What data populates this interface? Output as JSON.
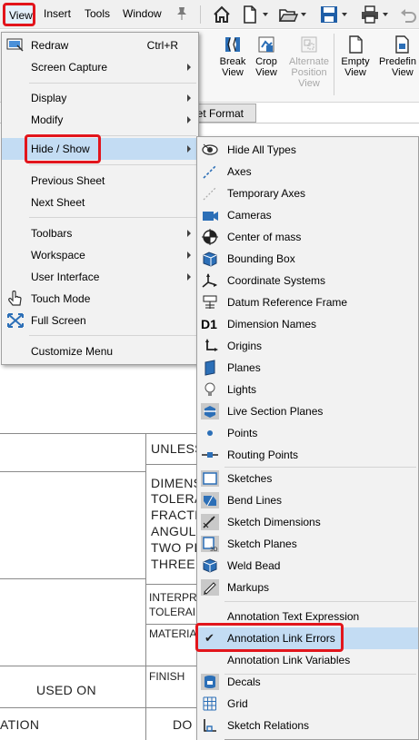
{
  "menubar": {
    "items": [
      "View",
      "Insert",
      "Tools",
      "Window"
    ],
    "pin_icon": "pin-icon"
  },
  "toolbar": {
    "icons": [
      "home-icon",
      "new-document-icon",
      "open-folder-icon",
      "save-icon",
      "print-icon",
      "undo-icon"
    ]
  },
  "ribbon": {
    "buttons": [
      {
        "label_1": "Break",
        "label_2": "View",
        "label_3": "",
        "icon": "break-view-icon",
        "enabled": true
      },
      {
        "label_1": "Crop",
        "label_2": "View",
        "label_3": "",
        "icon": "crop-view-icon",
        "enabled": true
      },
      {
        "label_1": "Alternate",
        "label_2": "Position",
        "label_3": "View",
        "icon": "alternate-position-view-icon",
        "enabled": false
      },
      {
        "label_1": "Empty",
        "label_2": "View",
        "label_3": "",
        "icon": "empty-view-icon",
        "enabled": true
      },
      {
        "label_1": "Predefin",
        "label_2": "View",
        "label_3": "",
        "icon": "predefined-view-icon",
        "enabled": true
      }
    ],
    "sheet_tab": "eet Format"
  },
  "view_menu": {
    "items": [
      {
        "label": "Redraw",
        "shortcut": "Ctrl+R",
        "icon": "redraw-icon",
        "submenu": false
      },
      {
        "label": "Screen Capture",
        "shortcut": "",
        "icon": "",
        "submenu": true
      },
      {
        "label": "Display",
        "shortcut": "",
        "icon": "",
        "submenu": true
      },
      {
        "label": "Modify",
        "shortcut": "",
        "icon": "",
        "submenu": true
      },
      {
        "label": "Hide / Show",
        "shortcut": "",
        "icon": "",
        "submenu": true
      },
      {
        "label": "Previous Sheet",
        "shortcut": "",
        "icon": "",
        "submenu": false
      },
      {
        "label": "Next Sheet",
        "shortcut": "",
        "icon": "",
        "submenu": false
      },
      {
        "label": "Toolbars",
        "shortcut": "",
        "icon": "",
        "submenu": true
      },
      {
        "label": "Workspace",
        "shortcut": "",
        "icon": "",
        "submenu": true
      },
      {
        "label": "User Interface",
        "shortcut": "",
        "icon": "",
        "submenu": true
      },
      {
        "label": "Touch Mode",
        "shortcut": "",
        "icon": "touch-mode-icon",
        "submenu": false
      },
      {
        "label": "Full Screen",
        "shortcut": "",
        "icon": "full-screen-icon",
        "submenu": false
      },
      {
        "label": "Customize Menu",
        "shortcut": "",
        "icon": "",
        "submenu": false
      }
    ]
  },
  "hide_show_menu": {
    "items": [
      {
        "label": "Hide All Types",
        "icon": "hide-all-types-icon",
        "checked": false
      },
      {
        "label": "Axes",
        "icon": "axes-icon",
        "checked": false
      },
      {
        "label": "Temporary Axes",
        "icon": "temporary-axes-icon",
        "checked": false
      },
      {
        "label": "Cameras",
        "icon": "cameras-icon",
        "checked": false
      },
      {
        "label": "Center of mass",
        "icon": "center-of-mass-icon",
        "checked": false
      },
      {
        "label": "Bounding Box",
        "icon": "bounding-box-icon",
        "checked": false
      },
      {
        "label": "Coordinate Systems",
        "icon": "coordinate-systems-icon",
        "checked": false
      },
      {
        "label": "Datum Reference Frame",
        "icon": "datum-reference-frame-icon",
        "checked": false
      },
      {
        "label": "Dimension Names",
        "icon": "dimension-names-icon",
        "icon_text": "D1",
        "checked": false
      },
      {
        "label": "Origins",
        "icon": "origins-icon",
        "checked": false
      },
      {
        "label": "Planes",
        "icon": "planes-icon",
        "checked": false
      },
      {
        "label": "Lights",
        "icon": "lights-icon",
        "checked": false
      },
      {
        "label": "Live Section Planes",
        "icon": "live-section-planes-icon",
        "checked": false
      },
      {
        "label": "Points",
        "icon": "points-icon",
        "checked": false
      },
      {
        "label": "Routing Points",
        "icon": "routing-points-icon",
        "checked": false
      },
      {
        "label": "Sketches",
        "icon": "sketches-icon",
        "checked": false
      },
      {
        "label": "Bend Lines",
        "icon": "bend-lines-icon",
        "checked": false
      },
      {
        "label": "Sketch Dimensions",
        "icon": "sketch-dimensions-icon",
        "checked": false
      },
      {
        "label": "Sketch Planes",
        "icon": "sketch-planes-icon",
        "checked": false
      },
      {
        "label": "Weld Bead",
        "icon": "weld-bead-icon",
        "checked": false
      },
      {
        "label": "Markups",
        "icon": "markups-icon",
        "checked": false
      },
      {
        "label": "Annotation Text Expression",
        "icon": "",
        "checked": false
      },
      {
        "label": "Annotation Link Errors",
        "icon": "checkmark-icon",
        "checked": true
      },
      {
        "label": "Annotation Link Variables",
        "icon": "",
        "checked": false
      },
      {
        "label": "Decals",
        "icon": "decals-icon",
        "checked": false
      },
      {
        "label": "Grid",
        "icon": "grid-icon",
        "checked": false
      },
      {
        "label": "Sketch Relations",
        "icon": "sketch-relations-icon",
        "checked": false
      }
    ]
  },
  "drawing": {
    "texts": {
      "unless": "UNLESS",
      "dimens": "DIMENS",
      "tolera": "TOLERA",
      "fracti": "FRACTI",
      "angul": "ANGUL",
      "two_p": "TWO PI",
      "three_p": "THREE F",
      "interpr": "INTERPR",
      "tolerai": "TOLERAI",
      "materia": "MATERIA",
      "finish": "FINISH",
      "used_on": "USED ON",
      "ation": "ATION",
      "do": "DO"
    }
  },
  "colors": {
    "highlight_box": "#e2151c",
    "menu_background": "#f2f2f2",
    "hover_background": "#c3dcf3",
    "icon_blue": "#1e5fa8"
  }
}
